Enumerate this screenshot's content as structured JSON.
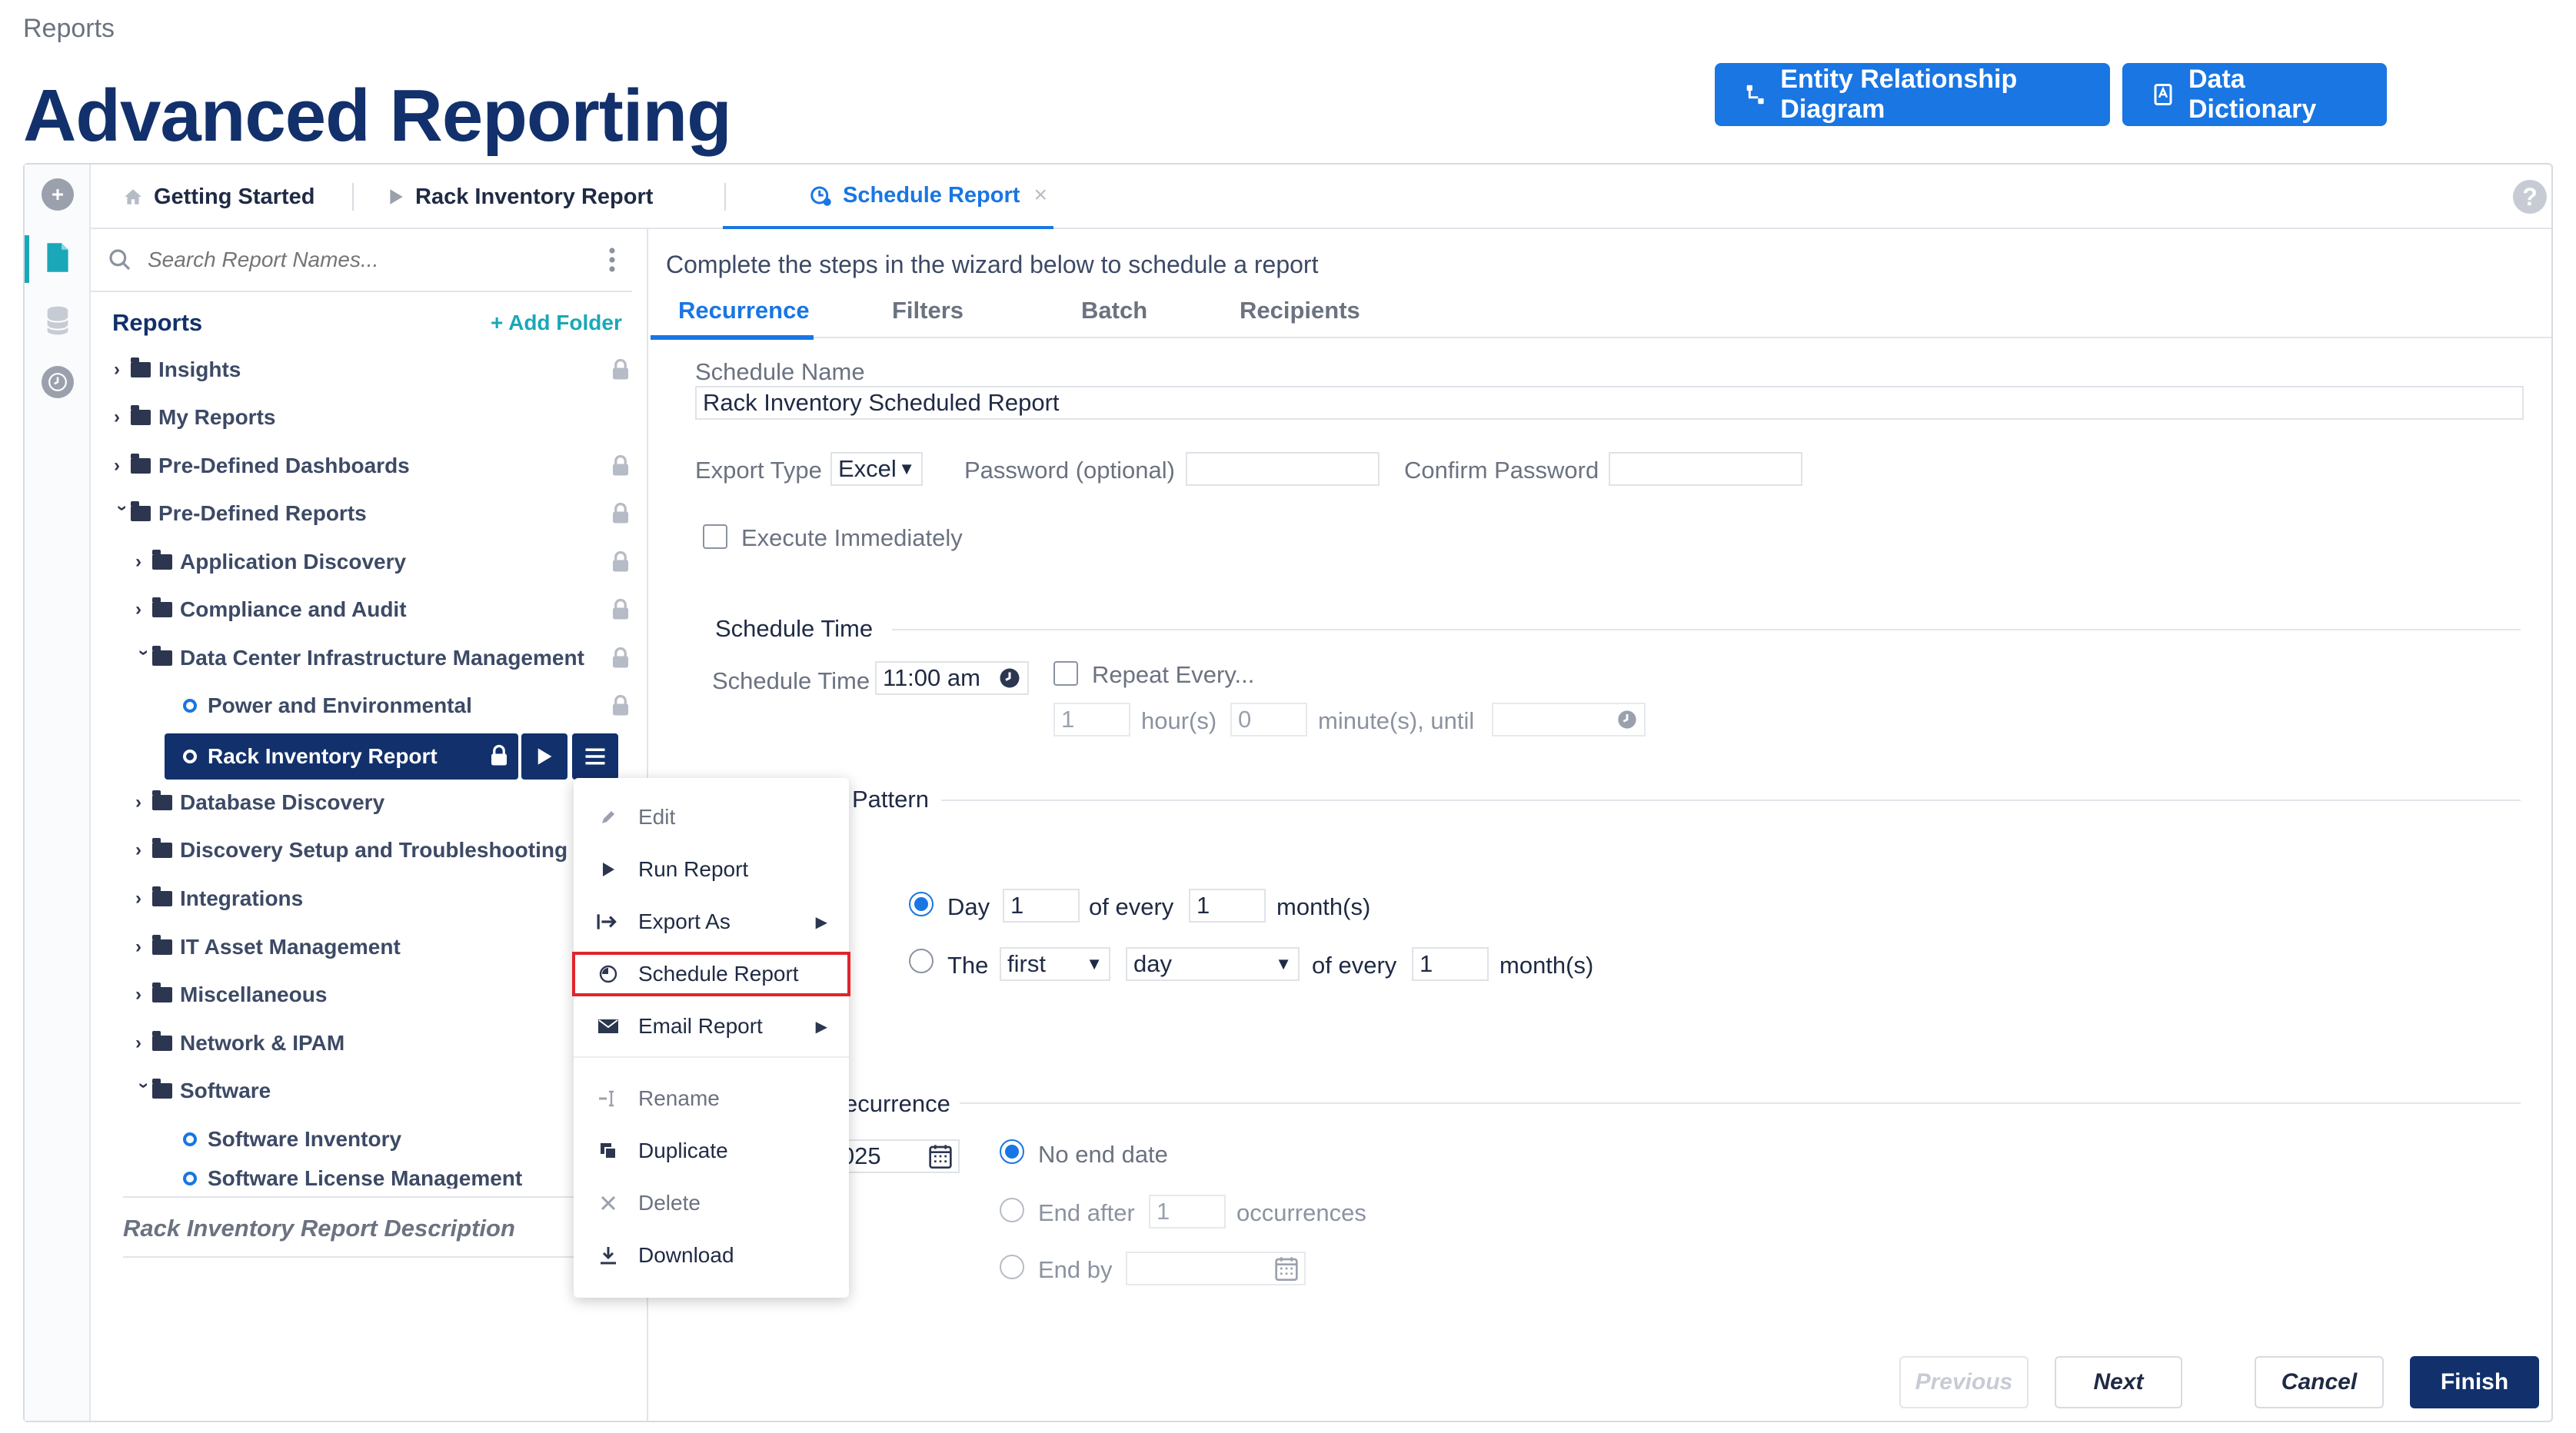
{
  "breadcrumb": "Reports",
  "page_title": "Advanced Reporting",
  "header_buttons": {
    "erd": "Entity Relationship Diagram",
    "dictionary": "Data Dictionary"
  },
  "tabs": [
    {
      "label": "Getting Started"
    },
    {
      "label": "Rack Inventory Report"
    },
    {
      "label": "Schedule Report"
    }
  ],
  "sidebar": {
    "search_placeholder": "Search Report Names...",
    "reports_heading": "Reports",
    "add_folder": "+ Add Folder",
    "tree": [
      {
        "label": "Insights"
      },
      {
        "label": "My Reports"
      },
      {
        "label": "Pre-Defined Dashboards"
      },
      {
        "label": "Pre-Defined Reports"
      },
      {
        "label": "Application Discovery"
      },
      {
        "label": "Compliance and Audit"
      },
      {
        "label": "Data Center Infrastructure Management"
      },
      {
        "label": "Power and Environmental"
      },
      {
        "label": "Rack Inventory Report"
      },
      {
        "label": "Database Discovery"
      },
      {
        "label": "Discovery Setup and Troubleshooting"
      },
      {
        "label": "Integrations"
      },
      {
        "label": "IT Asset Management"
      },
      {
        "label": "Miscellaneous"
      },
      {
        "label": "Network & IPAM"
      },
      {
        "label": "Software"
      },
      {
        "label": "Software Inventory"
      },
      {
        "label": "Software License Management"
      }
    ],
    "description_title": "Rack Inventory Report Description"
  },
  "context_menu": {
    "items": [
      {
        "label": "Edit"
      },
      {
        "label": "Run Report"
      },
      {
        "label": "Export As"
      },
      {
        "label": "Schedule Report"
      },
      {
        "label": "Email Report"
      },
      {
        "label": "Rename"
      },
      {
        "label": "Duplicate"
      },
      {
        "label": "Delete"
      },
      {
        "label": "Download"
      }
    ]
  },
  "wizard": {
    "intro": "Complete the steps in the wizard below to schedule a report",
    "steps": [
      "Recurrence",
      "Filters",
      "Batch",
      "Recipients"
    ],
    "schedule_name_label": "Schedule Name",
    "schedule_name_value": "Rack Inventory Scheduled Report",
    "export_type_label": "Export Type",
    "export_type_value": "Excel",
    "password_label": "Password (optional)",
    "confirm_password_label": "Confirm Password",
    "execute_immediately": "Execute Immediately",
    "schedule_time_section": "Schedule Time",
    "schedule_time_label": "Schedule Time",
    "schedule_time_value": "11:00 am",
    "repeat_every": "Repeat Every...",
    "repeat_hours_value": "1",
    "hours_label": "hour(s)",
    "repeat_minutes_value": "0",
    "minutes_until_label": "minute(s), until",
    "pattern_section": "Pattern",
    "day_label": "Day",
    "day_value": "1",
    "of_every_label": "of every",
    "of_every_value": "1",
    "months_label": "month(s)",
    "the_label": "The",
    "ordinal_value": "first",
    "weekday_value": "day",
    "of_every_label_2": "of every",
    "of_every_value_2": "1",
    "months_label_2": "month(s)",
    "recurrence_section": "ecurrence",
    "start_date_partial": "/2025",
    "no_end_date": "No end date",
    "end_after": "End after",
    "end_after_value": "1",
    "occurrences": "occurrences",
    "end_by": "End by"
  },
  "footer": {
    "previous": "Previous",
    "next": "Next",
    "cancel": "Cancel",
    "finish": "Finish"
  },
  "colors": {
    "primary": "#1976e3",
    "navy": "#12306b",
    "highlight": "#e0242c"
  }
}
